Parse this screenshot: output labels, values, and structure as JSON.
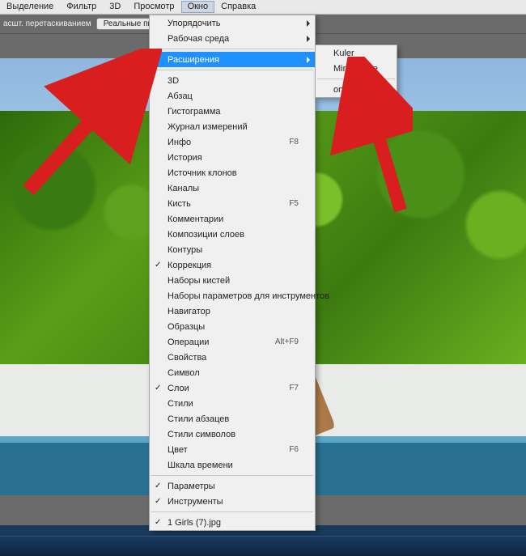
{
  "menubar": {
    "items": [
      "Выделение",
      "Фильтр",
      "3D",
      "Просмотр",
      "Окно",
      "Справка"
    ],
    "activeIndex": 4
  },
  "toolbar": {
    "drag_label": "асшт. перетаскиванием",
    "real_px_btn": "Реальные пикселы"
  },
  "window_menu": {
    "top": [
      {
        "label": "Упорядочить",
        "submenu": true
      },
      {
        "label": "Рабочая среда",
        "submenu": true
      }
    ],
    "highlight": {
      "label": "Расширения",
      "submenu": true
    },
    "mid": [
      {
        "label": "3D"
      },
      {
        "label": "Абзац"
      },
      {
        "label": "Гистограмма"
      },
      {
        "label": "Журнал измерений"
      },
      {
        "label": "Инфо",
        "shortcut": "F8"
      },
      {
        "label": "История"
      },
      {
        "label": "Источник клонов"
      },
      {
        "label": "Каналы"
      },
      {
        "label": "Кисть",
        "shortcut": "F5"
      },
      {
        "label": "Комментарии"
      },
      {
        "label": "Композиции слоев"
      },
      {
        "label": "Контуры"
      },
      {
        "label": "Коррекция",
        "checked": true
      },
      {
        "label": "Наборы кистей"
      },
      {
        "label": "Наборы параметров для инструментов"
      },
      {
        "label": "Навигатор"
      },
      {
        "label": "Образцы"
      },
      {
        "label": "Операции",
        "shortcut": "Alt+F9"
      },
      {
        "label": "Свойства"
      },
      {
        "label": "Символ"
      },
      {
        "label": "Слои",
        "checked": true,
        "shortcut": "F7"
      },
      {
        "label": "Стили"
      },
      {
        "label": "Стили абзацев"
      },
      {
        "label": "Стили символов"
      },
      {
        "label": "Цвет",
        "shortcut": "F6"
      },
      {
        "label": "Шкала времени"
      }
    ],
    "bottom1": [
      {
        "label": "Параметры",
        "checked": true
      },
      {
        "label": "Инструменты",
        "checked": true
      }
    ],
    "bottom2": [
      {
        "label": "1 Girls (7).jpg",
        "checked": true
      }
    ]
  },
  "submenu": {
    "items": [
      "Kuler",
      "Mini Bridge"
    ],
    "items2": [
      "onOne"
    ]
  }
}
